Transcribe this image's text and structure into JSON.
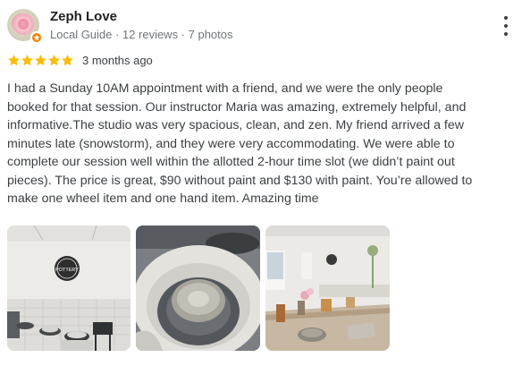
{
  "reviewer": {
    "name": "Zeph Love",
    "meta": "Local Guide · 12 reviews · 7 photos",
    "avatar_icon": "rose-avatar",
    "badge_icon": "local-guide-badge",
    "badge_color": "#f57c00"
  },
  "rating": {
    "stars": 5,
    "max_stars": 5,
    "star_color": "#fbbc04",
    "time_ago": "3 months ago"
  },
  "review_text": "I had a Sunday 10AM appointment with a friend, and we were the only people\nbooked for that session. Our instructor Maria was amazing, extremely helpful, and\ninformative.The studio was very spacious, clean, and zen. My friend arrived a few\nminutes late (snowstorm), and they were very accommodating. We were able to\ncomplete our session well within the allotted 2-hour time slot (we didn’t paint out\npieces). The price is great, $90 without paint and $130 with paint. You’re allowed to\nmake one wheel item and one hand item. Amazing time",
  "photos": [
    {
      "subject": "pottery studio with wheels and logo sign",
      "sign_text": "POTTERY"
    },
    {
      "subject": "clay bowl on pottery wheel"
    },
    {
      "subject": "studio table with pottery and flowers"
    }
  ],
  "menu_icon": "more-vert-icon"
}
